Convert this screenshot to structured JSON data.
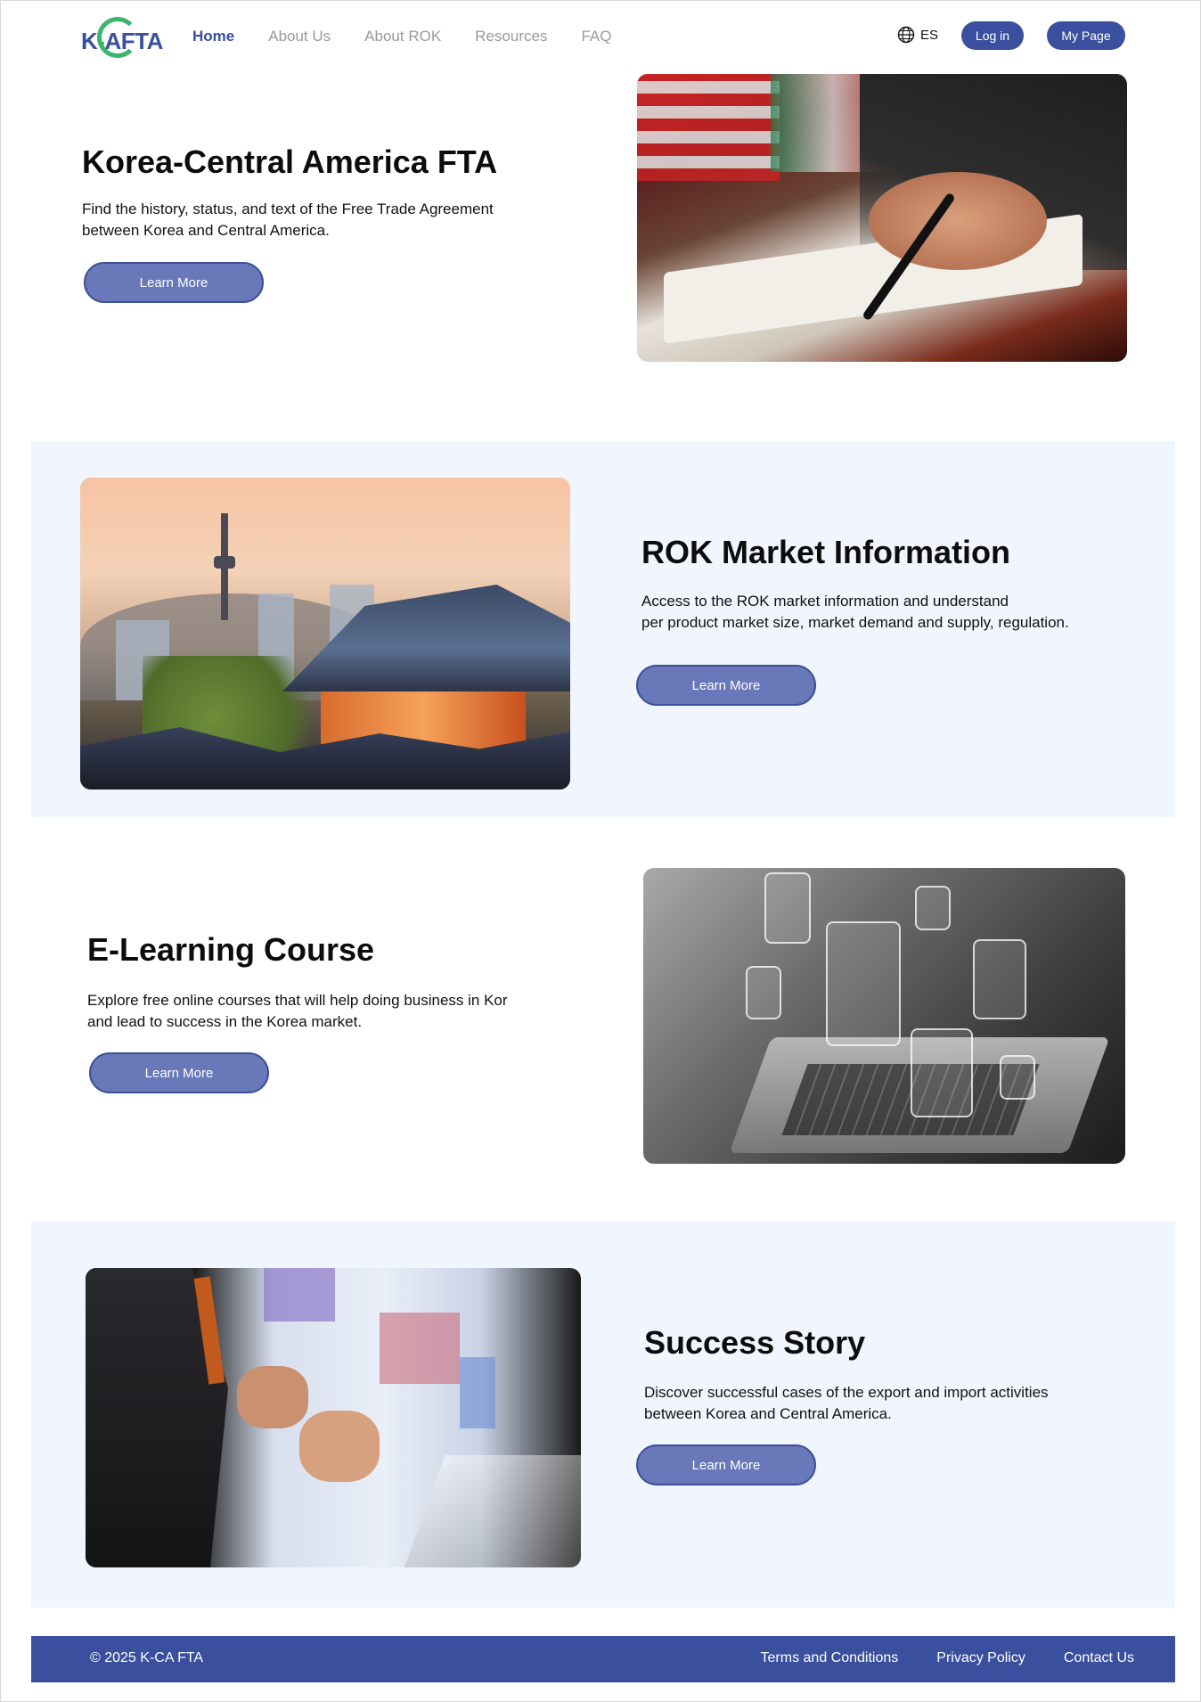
{
  "header": {
    "logo_text": "K-CAFTA",
    "nav": [
      {
        "label": "Home",
        "active": true
      },
      {
        "label": "About Us",
        "active": false
      },
      {
        "label": "About ROK",
        "active": false
      },
      {
        "label": "Resources",
        "active": false
      },
      {
        "label": "FAQ",
        "active": false
      }
    ],
    "language": "ES",
    "login_label": "Log in",
    "mypage_label": "My Page"
  },
  "sections": [
    {
      "title": "Korea-Central America FTA",
      "description_line1": "Find the history, status, and text of the Free Trade Agreement",
      "description_line2": "between Korea and Central America.",
      "button_label": "Learn More",
      "image": "signing-agreement-photo"
    },
    {
      "title": "ROK Market Information",
      "description_line1": "Access to the ROK market information and understand",
      "description_line2": "per product market size, market demand and supply, regulation.",
      "button_label": "Learn More",
      "image": "seoul-hanok-skyline-photo"
    },
    {
      "title": "E-Learning Course",
      "description_line1": "Explore free online courses that will help doing business in Kor",
      "description_line2": "and lead to success in the Korea market.",
      "button_label": "Learn More",
      "image": "elearning-laptop-photo"
    },
    {
      "title": "Success Story",
      "description_line1": "Discover successful cases of the export and import activities",
      "description_line2": "between Korea and Central America.",
      "button_label": "Learn More",
      "image": "presenter-photo"
    }
  ],
  "footer": {
    "copyright": "© 2025 K-CA FTA",
    "links": [
      "Terms and Conditions",
      "Privacy Policy",
      "Contact Us"
    ]
  },
  "colors": {
    "brand": "#3a4f9e",
    "button": "#6878b8",
    "tint": "#f1f5fd",
    "logo_green": "#3bb56b"
  }
}
